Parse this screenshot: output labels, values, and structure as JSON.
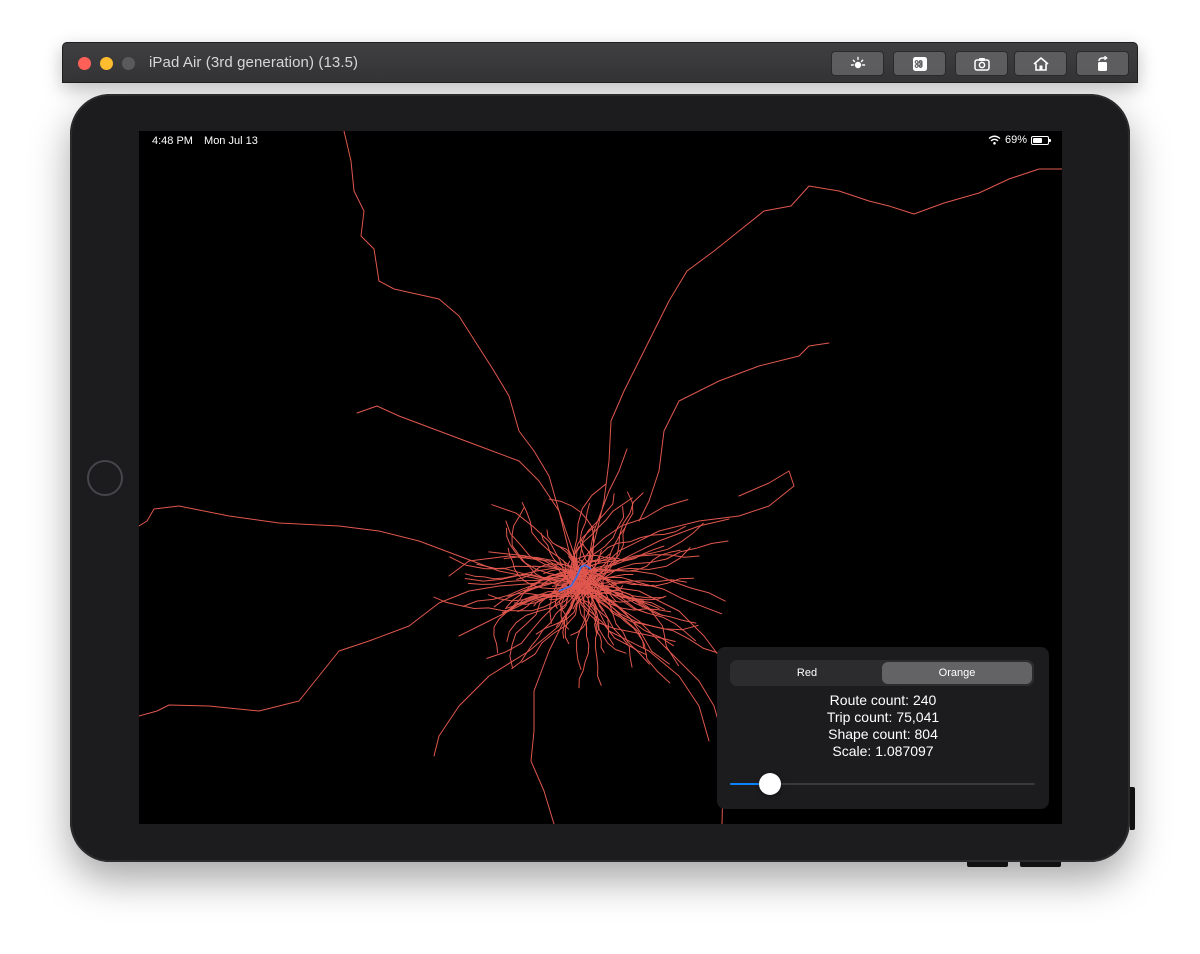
{
  "simulator": {
    "title": "iPad Air (3rd generation) (13.5)",
    "toolbar_buttons": [
      {
        "icon": "brightness-icon"
      },
      {
        "icon": "command-icon"
      },
      {
        "icon": "screenshot-icon"
      },
      {
        "icon": "home-icon"
      },
      {
        "icon": "rotate-icon"
      }
    ]
  },
  "status_bar": {
    "time": "4:48 PM",
    "date": "Mon Jul 13",
    "battery": "69%",
    "battery_level": 0.69
  },
  "map": {
    "route_color": "#e0574e",
    "highlight_color": "#3b6fe8",
    "background": "#000000"
  },
  "panel": {
    "segments": [
      {
        "label": "Red",
        "selected": false
      },
      {
        "label": "Orange",
        "selected": true
      }
    ],
    "route_count": "Route count: 240",
    "trip_count": "Trip count: 75,041",
    "shape_count": "Shape count: 804",
    "scale": "Scale: 1.087097",
    "slider_value": 0.13
  }
}
